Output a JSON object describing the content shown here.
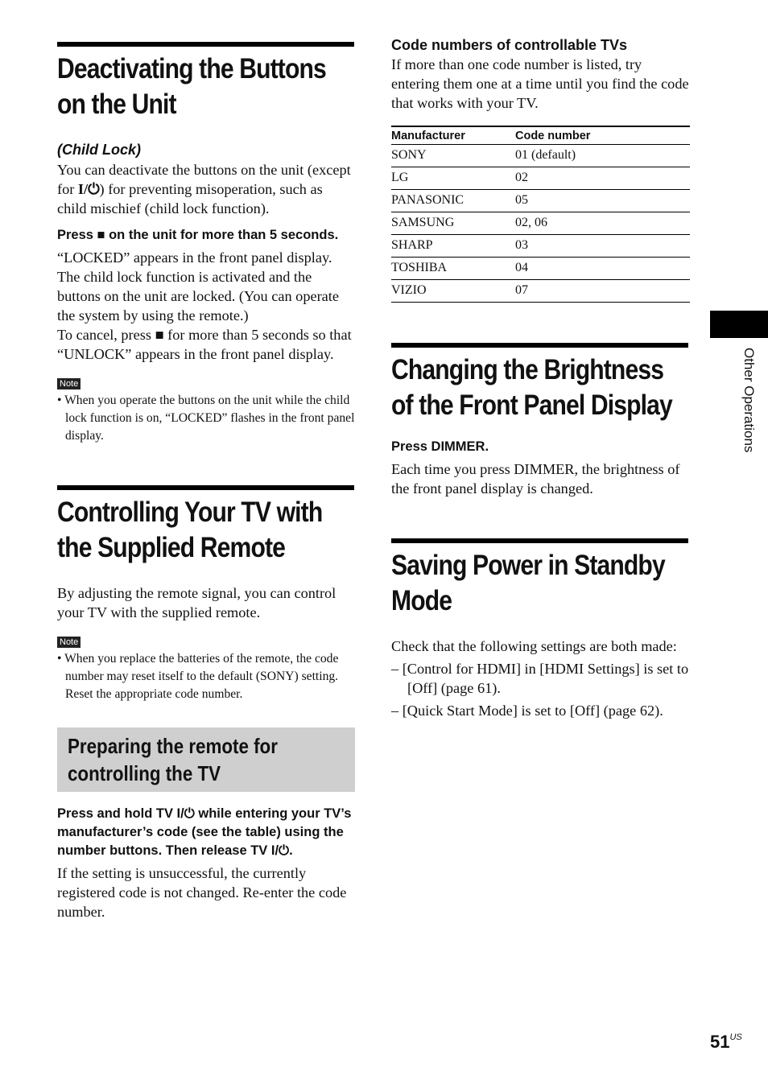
{
  "sections": {
    "child_lock": {
      "title": "Deactivating the Buttons on the Unit",
      "subtitle": "(Child Lock)",
      "intro_1": "You can deactivate the buttons on the unit (except for ",
      "power_symbol": "I/⏻",
      "intro_2": ") for preventing misoperation, such as child mischief (child lock function).",
      "step_1": "Press ",
      "stop_symbol": "■",
      "step_2": " on the unit for more than 5 seconds.",
      "body_1": "“LOCKED” appears in the front panel display. The child lock function is activated and the buttons on the unit are locked. (You can operate the system by using the remote.)",
      "body_2a": "To cancel, press ",
      "body_2b": " for more than 5 seconds so that “UNLOCK” appears in the front panel display.",
      "note_label": "Note",
      "note": "• When you operate the buttons on the unit while the child lock function is on, “LOCKED” flashes in the front panel display."
    },
    "tv_remote": {
      "title": "Controlling Your TV with the Supplied Remote",
      "body": "By adjusting the remote signal, you can control your TV with the supplied remote.",
      "note_label": "Note",
      "note": "• When you replace the batteries of the remote, the code number may reset itself to the default (SONY) setting. Reset the appropriate code number.",
      "subhead": "Preparing the remote for controlling the TV",
      "step_1": "Press and hold TV ",
      "step_2": " while entering your TV’s manufacturer’s code (see the table) using the number buttons. Then release TV ",
      "step_3": ".",
      "body_2": "If the setting is unsuccessful, the currently registered code is not changed. Re-enter the code number."
    },
    "codes": {
      "title": "Code numbers of controllable TVs",
      "body": "If more than one code number is listed, try entering them one at a time until you find the code that works with your TV.",
      "headers": [
        "Manufacturer",
        "Code number"
      ],
      "rows": [
        [
          "SONY",
          "01 (default)"
        ],
        [
          "LG",
          "02"
        ],
        [
          "PANASONIC",
          "05"
        ],
        [
          "SAMSUNG",
          "02, 06"
        ],
        [
          "SHARP",
          "03"
        ],
        [
          "TOSHIBA",
          "04"
        ],
        [
          "VIZIO",
          "07"
        ]
      ]
    },
    "brightness": {
      "title": "Changing the Brightness of the Front Panel Display",
      "step": "Press DIMMER.",
      "body": "Each time you press DIMMER, the brightness of the front panel display is changed."
    },
    "standby": {
      "title": "Saving Power in Standby Mode",
      "body": "Check that the following settings are both made:",
      "items": [
        "–  [Control for HDMI] in [HDMI Settings] is set to [Off] (page 61).",
        "–  [Quick Start Mode] is set to [Off] (page 62)."
      ]
    }
  },
  "side_tab": "Other Operations",
  "page": {
    "number": "51",
    "suffix": "US"
  }
}
